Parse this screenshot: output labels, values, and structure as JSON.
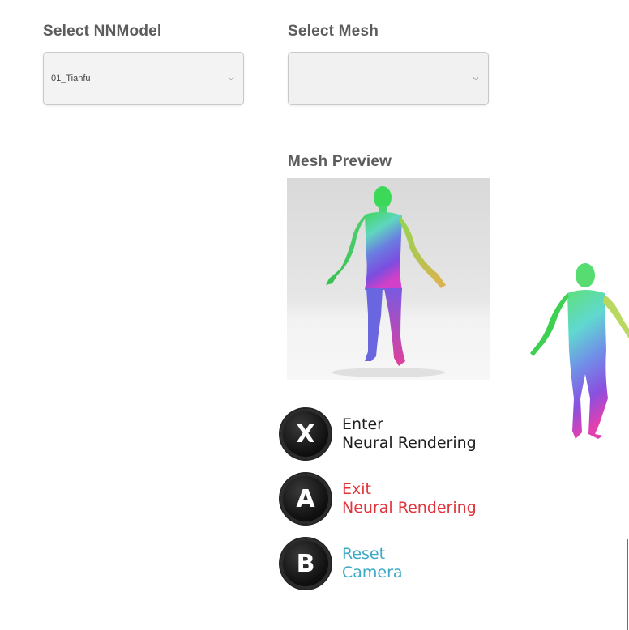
{
  "nnmodel": {
    "label": "Select NNModel",
    "selected": "01_Tianfu"
  },
  "mesh": {
    "label": "Select Mesh",
    "selected": ""
  },
  "preview": {
    "label": "Mesh Preview"
  },
  "controls": [
    {
      "key": "X",
      "line1": "Enter",
      "line2": "Neural Rendering",
      "color": "#1e1e1e"
    },
    {
      "key": "A",
      "line1": "Exit",
      "line2": "Neural Rendering",
      "color": "#e0353b"
    },
    {
      "key": "B",
      "line1": "Reset",
      "line2": "Camera",
      "color": "#3ba8c6"
    }
  ]
}
